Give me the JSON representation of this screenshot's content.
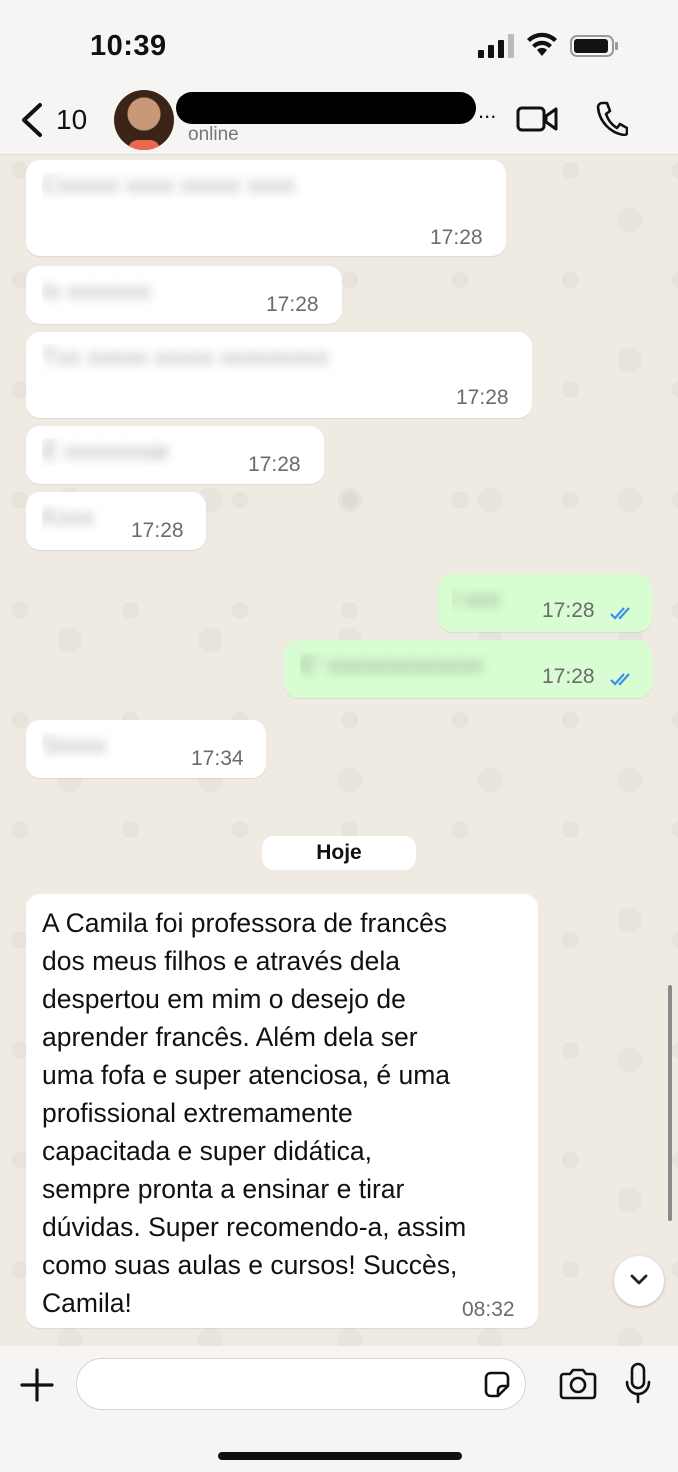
{
  "status_bar": {
    "time": "10:39"
  },
  "header": {
    "back_count": "10",
    "contact_status": "online",
    "name_overflow": "..."
  },
  "messages": [
    {
      "direction": "in",
      "time": "17:28"
    },
    {
      "direction": "in",
      "time": "17:28"
    },
    {
      "direction": "in",
      "time": "17:28"
    },
    {
      "direction": "in",
      "time": "17:28"
    },
    {
      "direction": "in",
      "time": "17:28"
    },
    {
      "direction": "out",
      "time": "17:28",
      "status": "read"
    },
    {
      "direction": "out",
      "time": "17:28",
      "status": "read"
    },
    {
      "direction": "in",
      "time": "17:34"
    }
  ],
  "day_separator": "Hoje",
  "last_message": {
    "text": "A Camila foi professora de francês\ndos meus filhos e através dela\ndespertou em mim o desejo de\naprender francês. Além dela ser\numa fofa e super atenciosa, é uma\nprofissional extremamente\ncapacitada  e super didática,\nsempre pronta a ensinar e tirar\ndúvidas. Super recomendo-a, assim\ncomo suas aulas e cursos! Succès,\nCamila!",
    "time": "08:32"
  },
  "colors": {
    "incoming": "#ffffff",
    "outgoing": "#d9fdd3",
    "read_ticks": "#3c91e6"
  }
}
